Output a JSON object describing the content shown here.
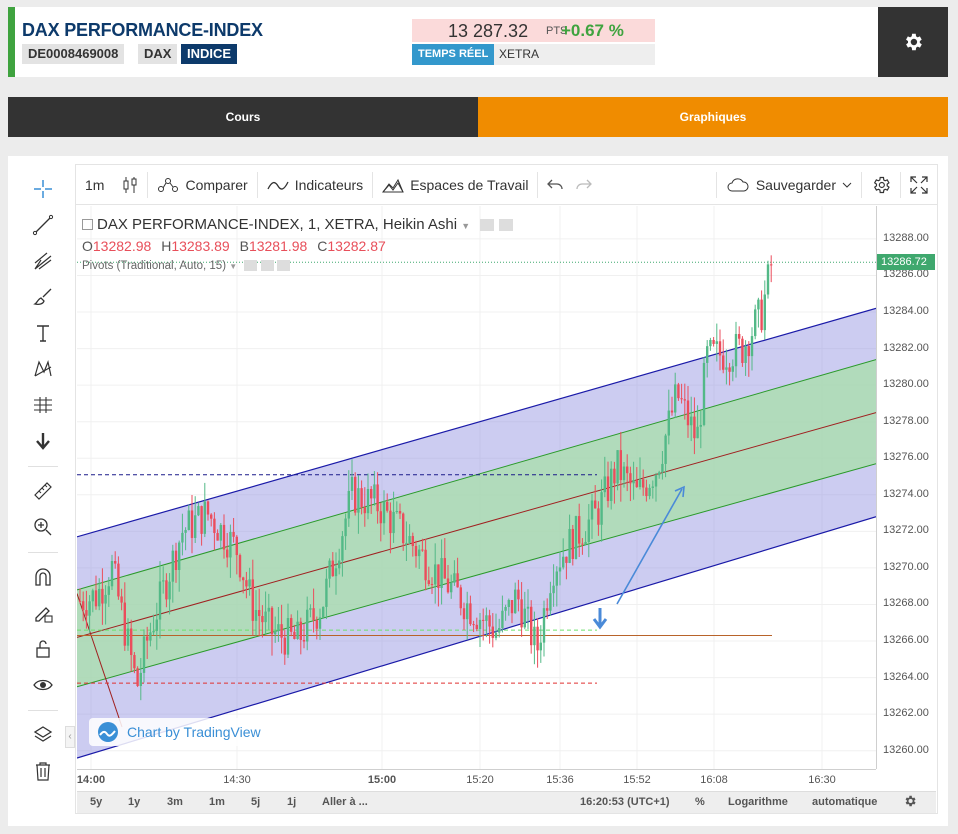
{
  "header": {
    "title": "DAX PERFORMANCE-INDEX",
    "isin": "DE0008469008",
    "ticker": "DAX",
    "type": "INDICE",
    "price": "13 287.32",
    "price_unit": "PTS",
    "change": "+0.67 %",
    "realtime": "TEMPS RÉEL",
    "venue": "XETRA"
  },
  "tabs": {
    "cours": "Cours",
    "graphiques": "Graphiques"
  },
  "toolbar": {
    "interval": "1m",
    "compare": "Comparer",
    "indicators": "Indicateurs",
    "workspaces": "Espaces de Travail",
    "save": "Sauvegarder"
  },
  "chart": {
    "legend_title": "DAX PERFORMANCE-INDEX, 1, XETRA, Heikin Ashi",
    "ohlc": {
      "o_label": "O",
      "o": "13282.98",
      "h_label": "H",
      "h": "13283.89",
      "b_label": "B",
      "b": "13281.98",
      "c_label": "C",
      "c": "13282.87"
    },
    "pivots": "Pivots (Traditional, Auto, 15)",
    "watermark": "Chart by TradingView",
    "last_price": "13286.72",
    "colors": {
      "up": "#53b987",
      "down": "#eb4d5c",
      "channel_outer": "#8e8ee0",
      "channel_inner": "#a8e0a8",
      "accent": "#f08c00"
    }
  },
  "chart_data": {
    "type": "candlestick",
    "y_ticks": [
      "13288.00",
      "13286.00",
      "13284.00",
      "13282.00",
      "13280.00",
      "13278.00",
      "13276.00",
      "13274.00",
      "13272.00",
      "13270.00",
      "13268.00",
      "13266.00",
      "13264.00",
      "13262.00",
      "13260.00"
    ],
    "x_ticks": [
      "14:00",
      "14:30",
      "15:00",
      "15:20",
      "15:36",
      "15:52",
      "16:08",
      "16:30"
    ],
    "ylim": [
      13259,
      13289.8
    ]
  },
  "bottom_bar": {
    "ranges": [
      "5y",
      "1y",
      "3m",
      "1m",
      "5j",
      "1j"
    ],
    "goto": "Aller à ...",
    "clock": "16:20:53 (UTC+1)",
    "percent": "%",
    "log": "Logarithme",
    "auto": "automatique"
  }
}
